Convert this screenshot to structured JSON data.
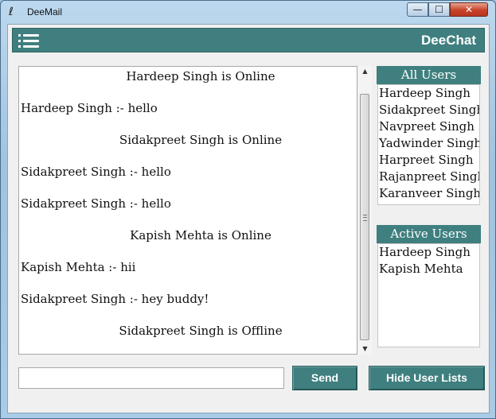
{
  "window": {
    "title": "DeeMail",
    "min_glyph": "—",
    "max_glyph": "☐",
    "close_glyph": "✕"
  },
  "header": {
    "app_title": "DeeChat",
    "menu_icon": "hamburger-menu-icon"
  },
  "chat": {
    "messages": [
      {
        "text": "Hardeep Singh is Online",
        "align": "center"
      },
      {
        "text": "Hardeep Singh :- hello",
        "align": "left"
      },
      {
        "text": "Sidakpreet Singh is Online",
        "align": "center"
      },
      {
        "text": "Sidakpreet Singh :- hello",
        "align": "left"
      },
      {
        "text": "Sidakpreet Singh :- hello",
        "align": "left"
      },
      {
        "text": "Kapish Mehta is Online",
        "align": "center"
      },
      {
        "text": "Kapish Mehta :- hii",
        "align": "left"
      },
      {
        "text": "Sidakpreet Singh :- hey buddy!",
        "align": "left"
      },
      {
        "text": "Sidakpreet Singh is Offline",
        "align": "center"
      }
    ]
  },
  "all_users": {
    "label": "All Users",
    "users": [
      "Hardeep Singh",
      "Sidakpreet Singh",
      "Navpreet Singh",
      "Yadwinder Singh",
      "Harpreet Singh",
      "Rajanpreet Singh",
      "Karanveer Singh"
    ]
  },
  "active_users": {
    "label": "Active Users",
    "users": [
      "Hardeep Singh",
      "Kapish Mehta"
    ]
  },
  "input": {
    "value": "",
    "placeholder": ""
  },
  "buttons": {
    "send_label": "Send",
    "hide_lists_label": "Hide User Lists"
  },
  "colors": {
    "accent": "#3f7f7f",
    "panel_bg": "#f0f0f0"
  }
}
